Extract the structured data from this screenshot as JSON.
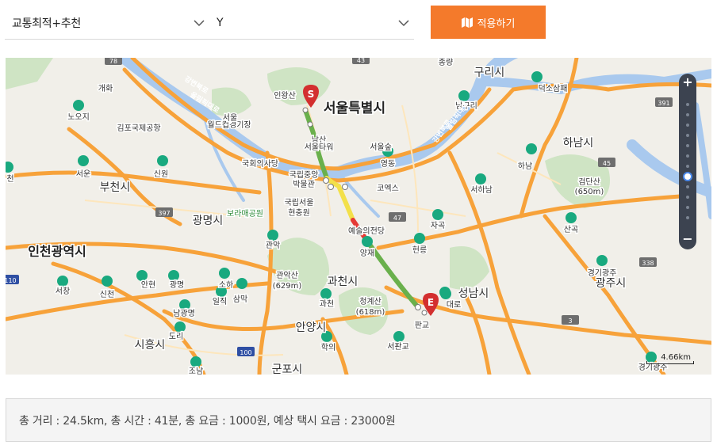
{
  "toolbar": {
    "route_option": "교통최적+추천",
    "second_option": "Y",
    "apply_label": "적용하기"
  },
  "map": {
    "labels": [
      {
        "t": "종량",
        "k": "sm"
      },
      {
        "t": "구리시",
        "k": "city"
      },
      {
        "t": "덕소삼패",
        "k": "sm"
      },
      {
        "t": "개화",
        "k": "sm"
      },
      {
        "t": "인왕산",
        "k": "sm"
      },
      {
        "t": "서울특별시",
        "k": "big"
      },
      {
        "t": "남구리",
        "k": "sm"
      },
      {
        "t": "노오지",
        "k": "sm"
      },
      {
        "t": "김포국제공항",
        "k": "sm"
      },
      {
        "t": "월드컵경기장",
        "k": "sm"
      },
      {
        "t": "서울",
        "k": "sm"
      },
      {
        "t": "남산",
        "k": "sm"
      },
      {
        "t": "서울타워",
        "k": "sm"
      },
      {
        "t": "서울숲",
        "k": "sm"
      },
      {
        "t": "하남시",
        "k": "city"
      },
      {
        "t": "국회의사당",
        "k": "sm"
      },
      {
        "t": "영동",
        "k": "sm"
      },
      {
        "t": "하남",
        "k": "sm"
      },
      {
        "t": "서운",
        "k": "sm"
      },
      {
        "t": "신원",
        "k": "sm"
      },
      {
        "t": "국립중앙",
        "k": "sm"
      },
      {
        "t": "박물관",
        "k": "sm"
      },
      {
        "t": "코엑스",
        "k": "sm"
      },
      {
        "t": "검단산",
        "k": "sm"
      },
      {
        "t": "(650m)",
        "k": "sm"
      },
      {
        "t": "서하남",
        "k": "sm"
      },
      {
        "t": "부천시",
        "k": "city"
      },
      {
        "t": "보라매공원",
        "k": "park"
      },
      {
        "t": "국립서울",
        "k": "sm"
      },
      {
        "t": "현충원",
        "k": "sm"
      },
      {
        "t": "광명시",
        "k": "city"
      },
      {
        "t": "자곡",
        "k": "sm"
      },
      {
        "t": "산곡",
        "k": "sm"
      },
      {
        "t": "예술의전당",
        "k": "sm"
      },
      {
        "t": "인천광역시",
        "k": "big2"
      },
      {
        "t": "관악",
        "k": "sm"
      },
      {
        "t": "양재",
        "k": "sm"
      },
      {
        "t": "헌릉",
        "k": "sm"
      },
      {
        "t": "경기광주",
        "k": "sm"
      },
      {
        "t": "관악산",
        "k": "sm"
      },
      {
        "t": "(629m)",
        "k": "sm"
      },
      {
        "t": "과천시",
        "k": "city"
      },
      {
        "t": "광주시",
        "k": "city"
      },
      {
        "t": "서창",
        "k": "sm"
      },
      {
        "t": "신천",
        "k": "sm"
      },
      {
        "t": "안현",
        "k": "sm"
      },
      {
        "t": "광명",
        "k": "sm"
      },
      {
        "t": "소하",
        "k": "sm"
      },
      {
        "t": "일직",
        "k": "sm"
      },
      {
        "t": "삼막",
        "k": "sm"
      },
      {
        "t": "과천",
        "k": "sm"
      },
      {
        "t": "청계산",
        "k": "sm"
      },
      {
        "t": "(618m)",
        "k": "sm"
      },
      {
        "t": "판교",
        "k": "sm"
      },
      {
        "t": "성남시",
        "k": "city"
      },
      {
        "t": "남광명",
        "k": "sm"
      },
      {
        "t": "도리",
        "k": "sm"
      },
      {
        "t": "안양시",
        "k": "city"
      },
      {
        "t": "시흥시",
        "k": "city"
      },
      {
        "t": "학의",
        "k": "sm"
      },
      {
        "t": "서판교",
        "k": "sm"
      },
      {
        "t": "조남",
        "k": "sm"
      },
      {
        "t": "군포시",
        "k": "city"
      },
      {
        "t": "경기광주",
        "k": "sm"
      },
      {
        "t": "천",
        "k": "sm"
      },
      {
        "t": "대로",
        "k": "sm"
      }
    ],
    "river_labels": [
      "강변북로",
      "올림픽대로",
      "강변북로",
      "올림픽대로"
    ],
    "route_badges": [
      "78",
      "391",
      "397",
      "47",
      "45",
      "338",
      "110",
      "100",
      "3",
      "43"
    ],
    "start_marker": "S",
    "end_marker": "E",
    "zoom_in": "+",
    "zoom_out": "−",
    "scale_label": "4.66km"
  },
  "summary": {
    "text": "총 거리 : 24.5km, 총 시간 : 41분, 총 요금 : 1000원, 예상 택시 요금 : 23000원"
  }
}
